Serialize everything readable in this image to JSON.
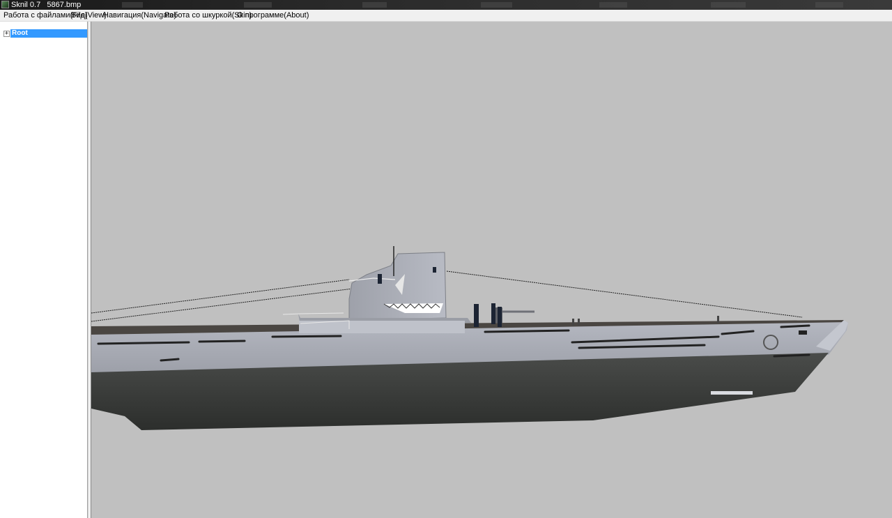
{
  "window": {
    "title": "Sknil 0.7   5867.bmp"
  },
  "menu": [
    {
      "label": "Работа с файлами(File)"
    },
    {
      "label": "Вид(View)"
    },
    {
      "label": "Навигация(Navigate)"
    },
    {
      "label": "Работа со шкуркой(Skin)"
    },
    {
      "label": "О программе(About)"
    }
  ],
  "tree": {
    "root": {
      "label": "Root",
      "expander": "+"
    }
  },
  "viewport": {
    "background": "#c0c0c0",
    "model_color_hull": "#a9acb4",
    "model_color_lower": "#3a3c3a"
  }
}
